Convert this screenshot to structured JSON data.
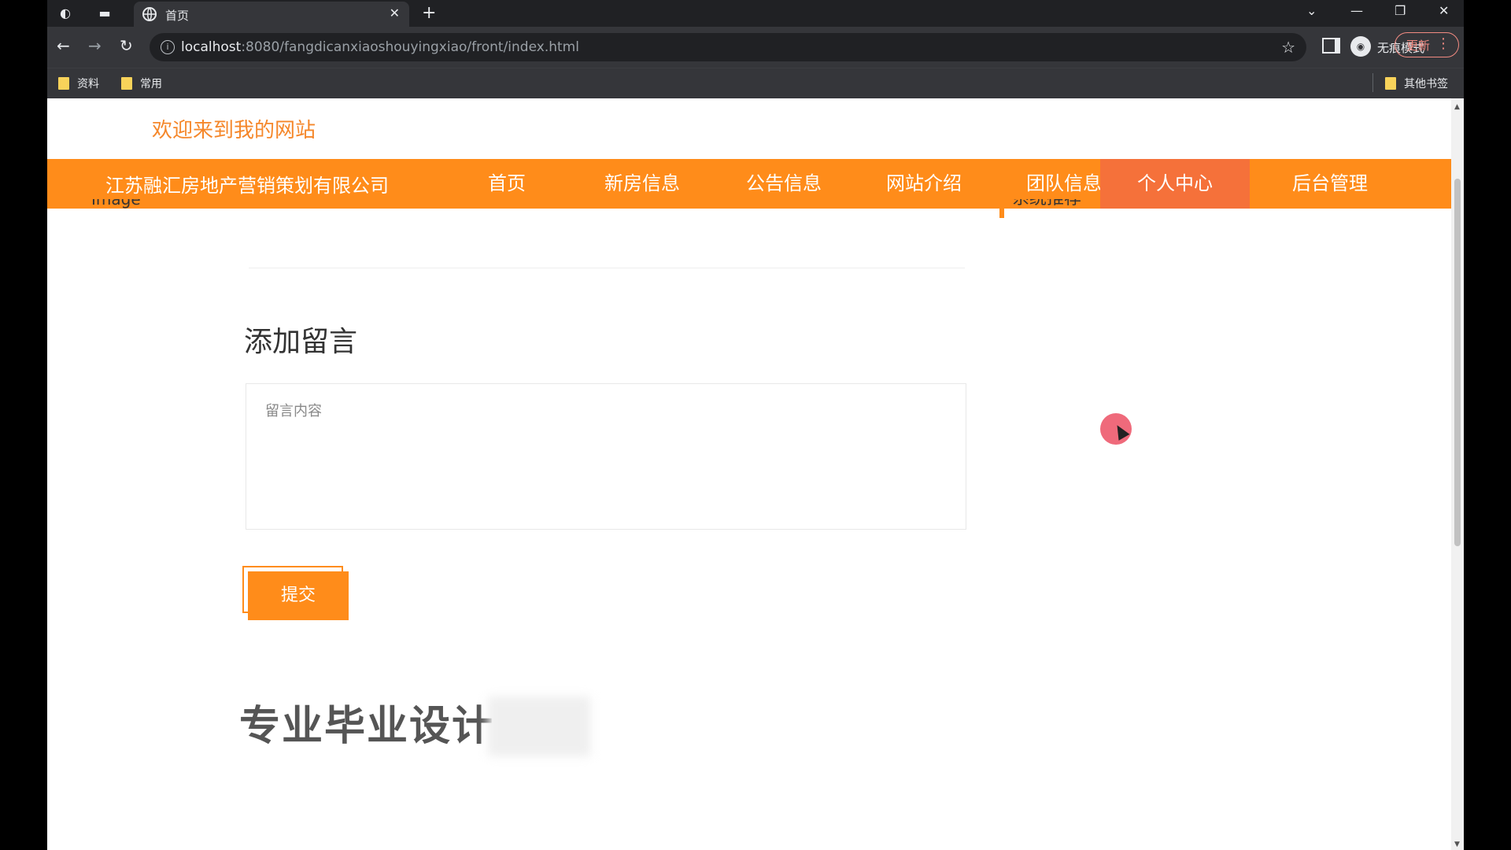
{
  "browser": {
    "tab_title": "首页",
    "url_host": "localhost",
    "url_path": ":8080/fangdicanxiaoshouyingxiao/front/index.html",
    "incognito_label": "无痕模式",
    "update_label": "更新",
    "bookmarks": [
      "资料",
      "常用"
    ],
    "other_bookmarks": "其他书签"
  },
  "site": {
    "welcome": "欢迎来到我的网站",
    "company": "江苏融汇房地产营销策划有限公司",
    "nav": [
      {
        "label": "首页",
        "active": false
      },
      {
        "label": "新房信息",
        "active": false
      },
      {
        "label": "公告信息",
        "active": false
      },
      {
        "label": "网站介绍",
        "active": false
      },
      {
        "label": "团队信息",
        "active": false
      },
      {
        "label": "个人中心",
        "active": true
      },
      {
        "label": "后台管理",
        "active": false
      }
    ]
  },
  "content": {
    "left_fragment": "Image",
    "right_fragment": "系统推荐",
    "section_title": "添加留言",
    "textarea_placeholder": "留言内容",
    "submit_label": "提交"
  },
  "footer": {
    "title": "专业毕业设计"
  },
  "colors": {
    "accent": "#ff8c1a",
    "accent_active": "#f5713a",
    "welcome_text": "#f5872a"
  }
}
